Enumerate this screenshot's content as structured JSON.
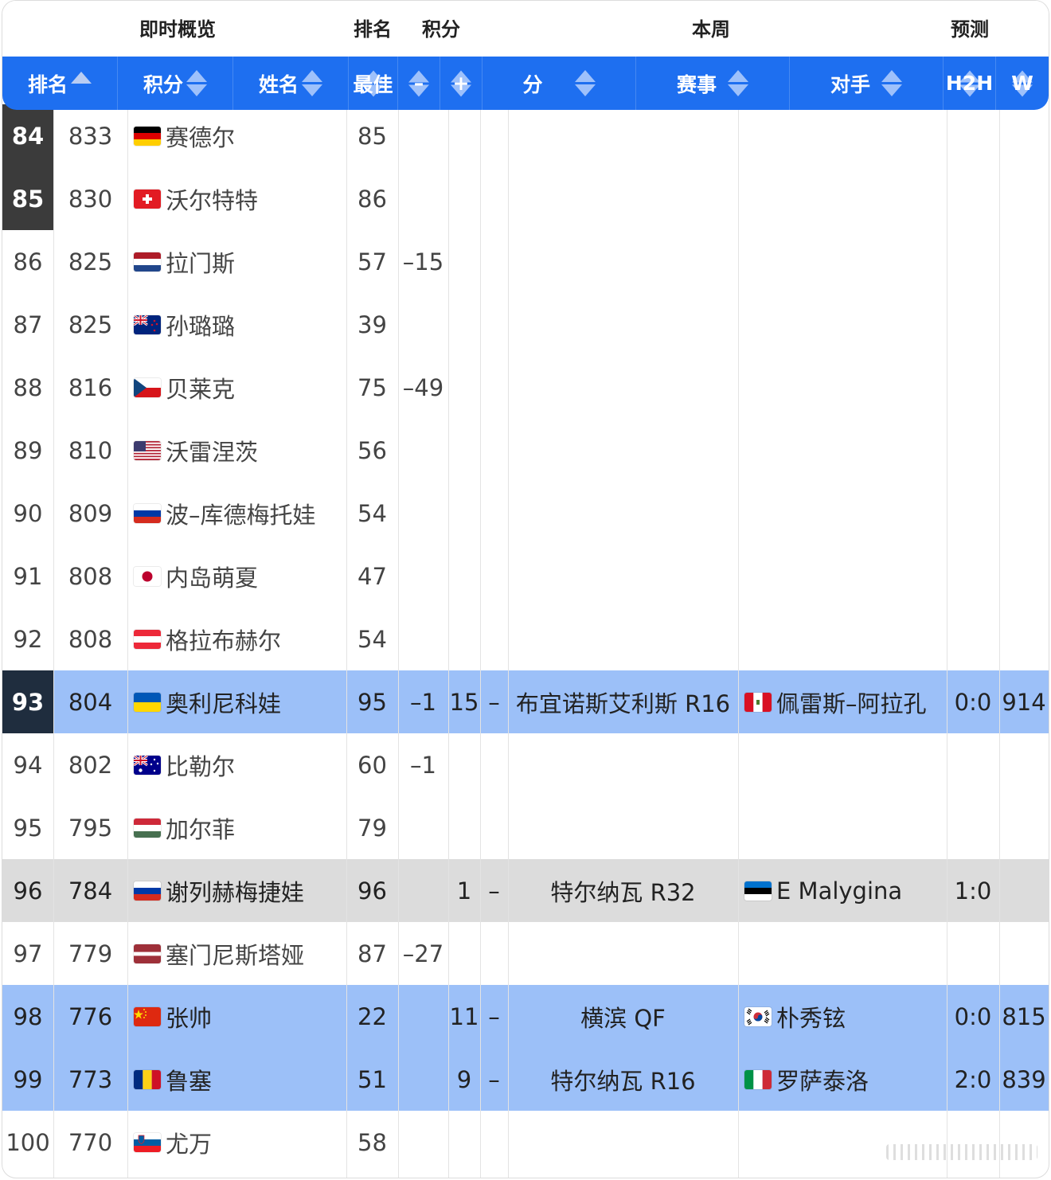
{
  "group_header": {
    "overview": "即时概览",
    "rank": "排名",
    "points": "积分",
    "this_week": "本周",
    "forecast": "预测"
  },
  "columns": {
    "rank": "排名",
    "points": "积分",
    "name": "姓名",
    "best": "最佳",
    "minus": "–",
    "plus": "+",
    "week_points": "分",
    "event": "赛事",
    "opponent": "对手",
    "h2h": "H2H",
    "w": "W"
  },
  "colors": {
    "header_blue": "#1e6ff0",
    "highlight_blue": "#9cc0f8",
    "highlight_gray": "#dcdcdc",
    "rank_badge": "#3b3b3b",
    "rank_badge_dark": "#1f2d3e"
  },
  "rows": [
    {
      "rank": "84",
      "points": "833",
      "flag": "germany",
      "name": "赛德尔",
      "best": "85",
      "minus": "",
      "plus": "",
      "dash": "",
      "event": "",
      "opp_flag": "",
      "opponent": "",
      "h2h": "",
      "w": "",
      "style": "badge"
    },
    {
      "rank": "85",
      "points": "830",
      "flag": "switzerland",
      "name": "沃尔特特",
      "best": "86",
      "minus": "",
      "plus": "",
      "dash": "",
      "event": "",
      "opp_flag": "",
      "opponent": "",
      "h2h": "",
      "w": "",
      "style": "badge"
    },
    {
      "rank": "86",
      "points": "825",
      "flag": "netherlands",
      "name": "拉门斯",
      "best": "57",
      "minus": "–15",
      "plus": "",
      "dash": "",
      "event": "",
      "opp_flag": "",
      "opponent": "",
      "h2h": "",
      "w": "",
      "style": ""
    },
    {
      "rank": "87",
      "points": "825",
      "flag": "new-zealand",
      "name": "孙璐璐",
      "best": "39",
      "minus": "",
      "plus": "",
      "dash": "",
      "event": "",
      "opp_flag": "",
      "opponent": "",
      "h2h": "",
      "w": "",
      "style": ""
    },
    {
      "rank": "88",
      "points": "816",
      "flag": "czech",
      "name": "贝莱克",
      "best": "75",
      "minus": "–49",
      "plus": "",
      "dash": "",
      "event": "",
      "opp_flag": "",
      "opponent": "",
      "h2h": "",
      "w": "",
      "style": ""
    },
    {
      "rank": "89",
      "points": "810",
      "flag": "usa",
      "name": "沃雷涅茨",
      "best": "56",
      "minus": "",
      "plus": "",
      "dash": "",
      "event": "",
      "opp_flag": "",
      "opponent": "",
      "h2h": "",
      "w": "",
      "style": ""
    },
    {
      "rank": "90",
      "points": "809",
      "flag": "russia",
      "name": "波–库德梅托娃",
      "best": "54",
      "minus": "",
      "plus": "",
      "dash": "",
      "event": "",
      "opp_flag": "",
      "opponent": "",
      "h2h": "",
      "w": "",
      "style": ""
    },
    {
      "rank": "91",
      "points": "808",
      "flag": "japan",
      "name": "内岛萌夏",
      "best": "47",
      "minus": "",
      "plus": "",
      "dash": "",
      "event": "",
      "opp_flag": "",
      "opponent": "",
      "h2h": "",
      "w": "",
      "style": ""
    },
    {
      "rank": "92",
      "points": "808",
      "flag": "austria",
      "name": "格拉布赫尔",
      "best": "54",
      "minus": "",
      "plus": "",
      "dash": "",
      "event": "",
      "opp_flag": "",
      "opponent": "",
      "h2h": "",
      "w": "",
      "style": ""
    },
    {
      "rank": "93",
      "points": "804",
      "flag": "ukraine",
      "name": "奥利尼科娃",
      "best": "95",
      "minus": "–1",
      "plus": "15",
      "dash": "–",
      "event": "布宜诺斯艾利斯 R16",
      "opp_flag": "peru",
      "opponent": "佩雷斯–阿拉孔",
      "h2h": "0:0",
      "w": "914",
      "style": "blue-dark"
    },
    {
      "rank": "94",
      "points": "802",
      "flag": "australia",
      "name": "比勒尔",
      "best": "60",
      "minus": "–1",
      "plus": "",
      "dash": "",
      "event": "",
      "opp_flag": "",
      "opponent": "",
      "h2h": "",
      "w": "",
      "style": ""
    },
    {
      "rank": "95",
      "points": "795",
      "flag": "hungary",
      "name": "加尔菲",
      "best": "79",
      "minus": "",
      "plus": "",
      "dash": "",
      "event": "",
      "opp_flag": "",
      "opponent": "",
      "h2h": "",
      "w": "",
      "style": ""
    },
    {
      "rank": "96",
      "points": "784",
      "flag": "russia",
      "name": "谢列赫梅捷娃",
      "best": "96",
      "minus": "",
      "plus": "1",
      "dash": "–",
      "event": "特尔纳瓦 R32",
      "opp_flag": "estonia",
      "opponent": "E Malygina",
      "h2h": "1:0",
      "w": "",
      "style": "gray"
    },
    {
      "rank": "97",
      "points": "779",
      "flag": "latvia",
      "name": "塞门尼斯塔娅",
      "best": "87",
      "minus": "–27",
      "plus": "",
      "dash": "",
      "event": "",
      "opp_flag": "",
      "opponent": "",
      "h2h": "",
      "w": "",
      "style": ""
    },
    {
      "rank": "98",
      "points": "776",
      "flag": "china",
      "name": "张帅",
      "best": "22",
      "minus": "",
      "plus": "11",
      "dash": "–",
      "event": "横滨 QF",
      "opp_flag": "korea",
      "opponent": "朴秀铉",
      "h2h": "0:0",
      "w": "815",
      "style": "blue"
    },
    {
      "rank": "99",
      "points": "773",
      "flag": "romania",
      "name": "鲁塞",
      "best": "51",
      "minus": "",
      "plus": "9",
      "dash": "–",
      "event": "特尔纳瓦 R16",
      "opp_flag": "italy",
      "opponent": "罗萨泰洛",
      "h2h": "2:0",
      "w": "839",
      "style": "blue"
    },
    {
      "rank": "100",
      "points": "770",
      "flag": "slovenia",
      "name": "尤万",
      "best": "58",
      "minus": "",
      "plus": "",
      "dash": "",
      "event": "",
      "opp_flag": "",
      "opponent": "",
      "h2h": "",
      "w": "",
      "style": ""
    }
  ]
}
